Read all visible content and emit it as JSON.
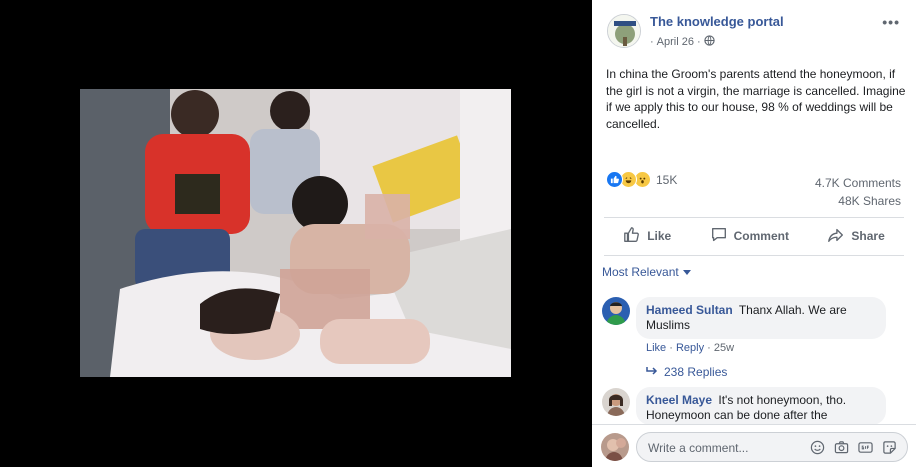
{
  "post": {
    "page_name": "The knowledge portal",
    "date": "April 26",
    "separator": "·",
    "text": "In china the Groom's parents attend the honeymoon, if the girl is not a virgin, the marriage is cancelled. Imagine if we apply this to our house, 98 % of weddings will be cancelled.",
    "more": "•••"
  },
  "stats": {
    "reaction_count": "15K",
    "comments": "4.7K Comments",
    "shares": "48K Shares"
  },
  "actions": {
    "like": "Like",
    "comment": "Comment",
    "share": "Share"
  },
  "filter": {
    "label": "Most Relevant"
  },
  "comments": [
    {
      "author": "Hameed Sultan",
      "text": "Thanx Allah. We are Muslims",
      "like": "Like",
      "reply": "Reply",
      "time": "25w",
      "replies": "238 Replies"
    },
    {
      "author": "Kneel Maye",
      "text": "It's not honeymoon, tho. Honeymoon can be done after the marriage."
    }
  ],
  "composer": {
    "placeholder": "Write a comment..."
  },
  "colors": {
    "link": "#385898",
    "secondary": "#606770",
    "bubble": "#f2f3f5"
  }
}
